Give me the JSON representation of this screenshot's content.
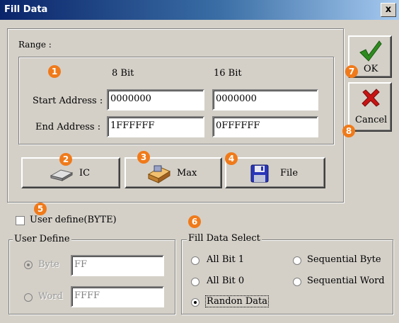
{
  "window": {
    "title": "Fill Data",
    "close_label": "x"
  },
  "range": {
    "label": "Range :",
    "col_8bit": "8 Bit",
    "col_16bit": "16 Bit",
    "start_label": "Start Address :",
    "end_label": "End Address :",
    "start_8bit": "0000000",
    "start_16bit": "0000000",
    "end_8bit": "1FFFFFF",
    "end_16bit": "0FFFFFF"
  },
  "buttons": {
    "ic": "IC",
    "max": "Max",
    "file": "File",
    "ok": "OK",
    "cancel": "Cancel"
  },
  "user_define": {
    "checkbox_label": "User define(BYTE)",
    "group_label": "User Define",
    "byte_label": "Byte",
    "byte_value": "FF",
    "word_label": "Word",
    "word_value": "FFFF"
  },
  "fill_select": {
    "group_label": "Fill Data Select",
    "all_bit_1": "All Bit 1",
    "all_bit_0": "All Bit 0",
    "random": "Randon Data",
    "seq_byte": "Sequential Byte",
    "seq_word": "Sequential Word",
    "selected": "Randon Data"
  },
  "badges": [
    "1",
    "2",
    "3",
    "4",
    "5",
    "6",
    "7",
    "8"
  ],
  "colors": {
    "badge": "#f07a1a",
    "ok_check": "#2e8b1f",
    "cancel_x": "#c81414"
  }
}
